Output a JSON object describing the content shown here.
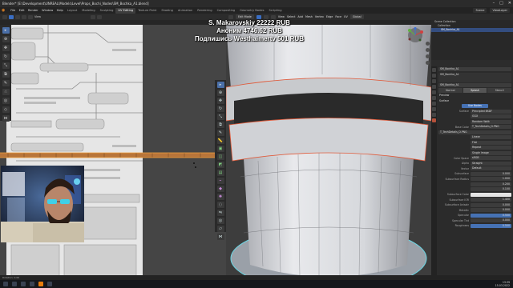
{
  "window": {
    "title": "Blender* [E:\\Development\\UNREAL\\Models\\Level\\Props_Bochi_Nodes\\SM_Bochka_A1.blend]"
  },
  "menu": {
    "items": [
      "File",
      "Edit",
      "Render",
      "Window",
      "Help"
    ],
    "workspaces": [
      "Layout",
      "Modeling",
      "Sculpting",
      "UV Editing",
      "Texture Paint",
      "Shading",
      "Animation",
      "Rendering",
      "Compositing",
      "Geometry Nodes",
      "Scripting"
    ],
    "active_workspace": "UV Editing",
    "scene": "Scene",
    "view_layer": "ViewLayer"
  },
  "uv_editor": {
    "header_view": "View",
    "status": "Rotation: 0.00"
  },
  "viewport": {
    "mode": "Edit Mode",
    "menus": [
      "View",
      "Select",
      "Add",
      "Mesh",
      "Vertex",
      "Edge",
      "Face",
      "UV"
    ],
    "transform_orientation": "Global"
  },
  "overlay": {
    "lines": [
      "S. Makarovskiy 22222 RUB",
      "Аноним 4746.62 RUB",
      "Подпишись Westhaimertv 501 RUB"
    ]
  },
  "outliner": {
    "rows": [
      {
        "label": "Scene Collection",
        "selected": false
      },
      {
        "label": "Collection",
        "selected": false
      },
      {
        "label": "SM_Bochka_A1",
        "selected": true
      }
    ]
  },
  "properties": {
    "object_name": "SM_Bochka_A1",
    "material_slot": "SM_Bochka_A1",
    "material_name": "SM_Bochka_A1",
    "material_tabs": [
      "Normal",
      "Splash",
      "Stencil"
    ],
    "preview_label": "Preview",
    "surface_label": "Surface",
    "use_nodes_label": "Use Nodes",
    "surface_shader": "Principled BSDF",
    "distribution": "GGX",
    "subsurface_method": "Random Walk",
    "base_color_label": "Base Color",
    "base_color_texture": "T_TechDetails_D.PNG",
    "image_name": "T_TechDetails_D.PNG",
    "interpolation": "Linear",
    "projection": "Flat",
    "extension": "Repeat",
    "source": "Single Image",
    "color_space_label": "Color Space",
    "color_space": "sRGB",
    "alpha_label": "Alpha",
    "alpha": "Straight",
    "vector_label": "Vector",
    "vector": "Default",
    "subsurface_label": "Subsurface",
    "subsurface": "0.000",
    "subsurface_radius_label": "Subsurface Radius",
    "subsurface_radius": [
      "1.000",
      "0.200",
      "0.100"
    ],
    "subsurface_color_label": "Subsurface Color",
    "subsurface_ior_label": "Subsurface IOR",
    "subsurface_ior": "1.400",
    "subsurface_anisotropy_label": "Subsurface Anisotr",
    "subsurface_anisotropy": "0.000",
    "metallic_label": "Metallic",
    "metallic": "0.000",
    "specular_label": "Specular",
    "specular": "0.500",
    "specular_tint_label": "Specular Tint",
    "specular_tint": "0.000",
    "roughness_label": "Roughness",
    "roughness": "0.500"
  },
  "taskbar": {
    "time": "13:39",
    "date": "15.03.2022"
  },
  "colors": {
    "accent_blue": "#4672b4",
    "blender_orange": "#e87d0d",
    "selection_orange": "#f0a040"
  }
}
